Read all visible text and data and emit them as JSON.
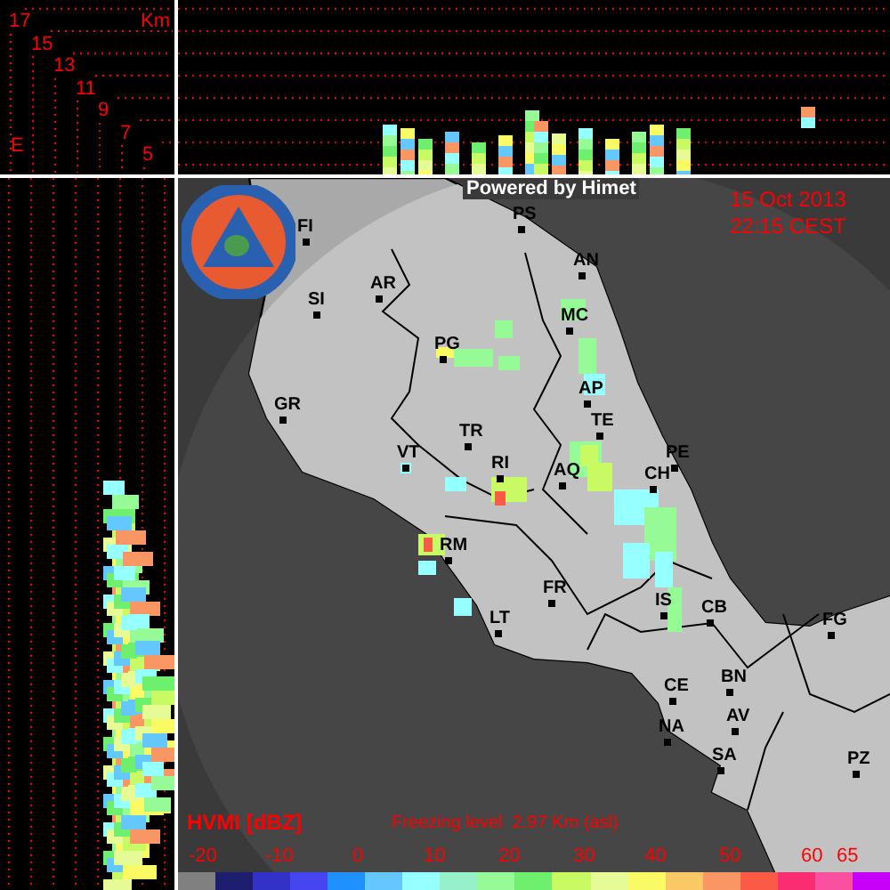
{
  "height_scale": {
    "unit": "Km",
    "labels": [
      "17",
      "15",
      "13",
      "11",
      "9",
      "7",
      "5"
    ],
    "axis_label": "E"
  },
  "header": {
    "credit": "Powered by Himet",
    "date": "15 Oct 2013",
    "time": "22:15 CEST"
  },
  "cities": [
    {
      "name": "FI"
    },
    {
      "name": "PS"
    },
    {
      "name": "AN"
    },
    {
      "name": "SI"
    },
    {
      "name": "AR"
    },
    {
      "name": "MC"
    },
    {
      "name": "PG"
    },
    {
      "name": "AP"
    },
    {
      "name": "GR"
    },
    {
      "name": "TE"
    },
    {
      "name": "TR"
    },
    {
      "name": "PE"
    },
    {
      "name": "VT"
    },
    {
      "name": "RI"
    },
    {
      "name": "AQ"
    },
    {
      "name": "CH"
    },
    {
      "name": "RM"
    },
    {
      "name": "FR"
    },
    {
      "name": "IS"
    },
    {
      "name": "CB"
    },
    {
      "name": "LT"
    },
    {
      "name": "FG"
    },
    {
      "name": "CE"
    },
    {
      "name": "BN"
    },
    {
      "name": "AV"
    },
    {
      "name": "NA"
    },
    {
      "name": "SA"
    },
    {
      "name": "PZ"
    }
  ],
  "legend": {
    "product": "HVMI [dBZ]",
    "freezing_level": "Freezing level  2.97 Km (asl)",
    "ticks": [
      "-20",
      "-10",
      "0",
      "10",
      "20",
      "30",
      "40",
      "50",
      "60",
      "65"
    ],
    "bins": [
      {
        "color": "#808080"
      },
      {
        "color": "#1e1e6e"
      },
      {
        "color": "#3232c8"
      },
      {
        "color": "#4646f0"
      },
      {
        "color": "#1e90ff"
      },
      {
        "color": "#64c8ff"
      },
      {
        "color": "#96ffff"
      },
      {
        "color": "#96f0c8"
      },
      {
        "color": "#96fa96"
      },
      {
        "color": "#6ef06e"
      },
      {
        "color": "#c8fa64"
      },
      {
        "color": "#e6fa96"
      },
      {
        "color": "#fafa64"
      },
      {
        "color": "#fac864"
      },
      {
        "color": "#fa9664"
      },
      {
        "color": "#fa5a46"
      },
      {
        "color": "#fa2d73"
      },
      {
        "color": "#fa50a0"
      },
      {
        "color": "#c800fa"
      }
    ]
  }
}
